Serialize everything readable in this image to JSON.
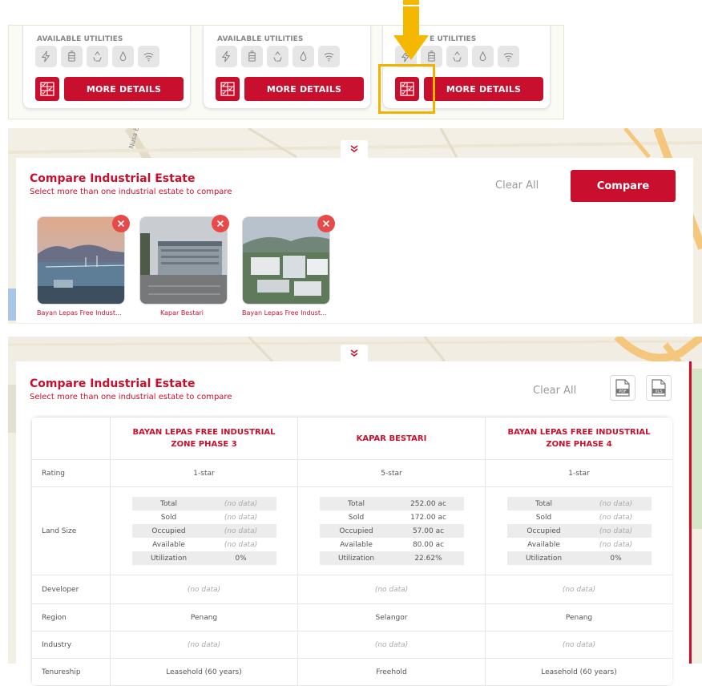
{
  "cards": [
    {
      "title": "AVAILABLE UTILITIES",
      "more_label": "MORE DETAILS"
    },
    {
      "title": "AVAILABLE UTILITIES",
      "more_label": "MORE DETAILS"
    },
    {
      "title": "E UTILITIES",
      "more_label": "MORE DETAILS"
    }
  ],
  "utility_icons": [
    "electricity-icon",
    "gas-icon",
    "recycle-icon",
    "water-icon",
    "wifi-icon"
  ],
  "compare_panel": {
    "title": "Compare Industrial Estate",
    "subtitle": "Select more than one industrial estate to compare",
    "clear_label": "Clear All",
    "compare_label": "Compare",
    "selected": [
      {
        "name": "Bayan Lepas Free Indust..."
      },
      {
        "name": "Kapar Bestari"
      },
      {
        "name": "Bayan Lepas Free Indust..."
      }
    ]
  },
  "compare_table": {
    "title": "Compare Industrial Estate",
    "subtitle": "Select more than one industrial estate to compare",
    "clear_label": "Clear All",
    "pdf_label": "PDF",
    "xls_label": "XLS",
    "columns": [
      "BAYAN LEPAS FREE INDUSTRIAL ZONE PHASE 3",
      "KAPAR BESTARI",
      "BAYAN LEPAS FREE INDUSTRIAL ZONE PHASE 4"
    ],
    "rows": {
      "rating": {
        "label": "Rating",
        "values": [
          "1-star",
          "5-star",
          "1-star"
        ]
      },
      "land": {
        "label": "Land Size",
        "fields": [
          "Total",
          "Sold",
          "Occupied",
          "Available",
          "Utilization"
        ],
        "values": [
          [
            "(no data)",
            "(no data)",
            "(no data)",
            "(no data)",
            "0%"
          ],
          [
            "252.00 ac",
            "172.00 ac",
            "57.00 ac",
            "80.00 ac",
            "22.62%"
          ],
          [
            "(no data)",
            "(no data)",
            "(no data)",
            "(no data)",
            "0%"
          ]
        ]
      },
      "developer": {
        "label": "Developer",
        "values": [
          "(no data)",
          "(no data)",
          "(no data)"
        ]
      },
      "region": {
        "label": "Region",
        "values": [
          "Penang",
          "Selangor",
          "Penang"
        ]
      },
      "industry": {
        "label": "Industry",
        "values": [
          "(no data)",
          "(no data)",
          "(no data)"
        ]
      },
      "tenureship": {
        "label": "Tenureship",
        "values": [
          "Leasehold (60 years)",
          "Freehold",
          "Leasehold (60 years)"
        ]
      }
    }
  },
  "map": {
    "street_label": "Nusa B"
  },
  "colors": {
    "brand_red": "#c8102e",
    "highlight": "#f0b400",
    "arrow": "#f5b800"
  }
}
